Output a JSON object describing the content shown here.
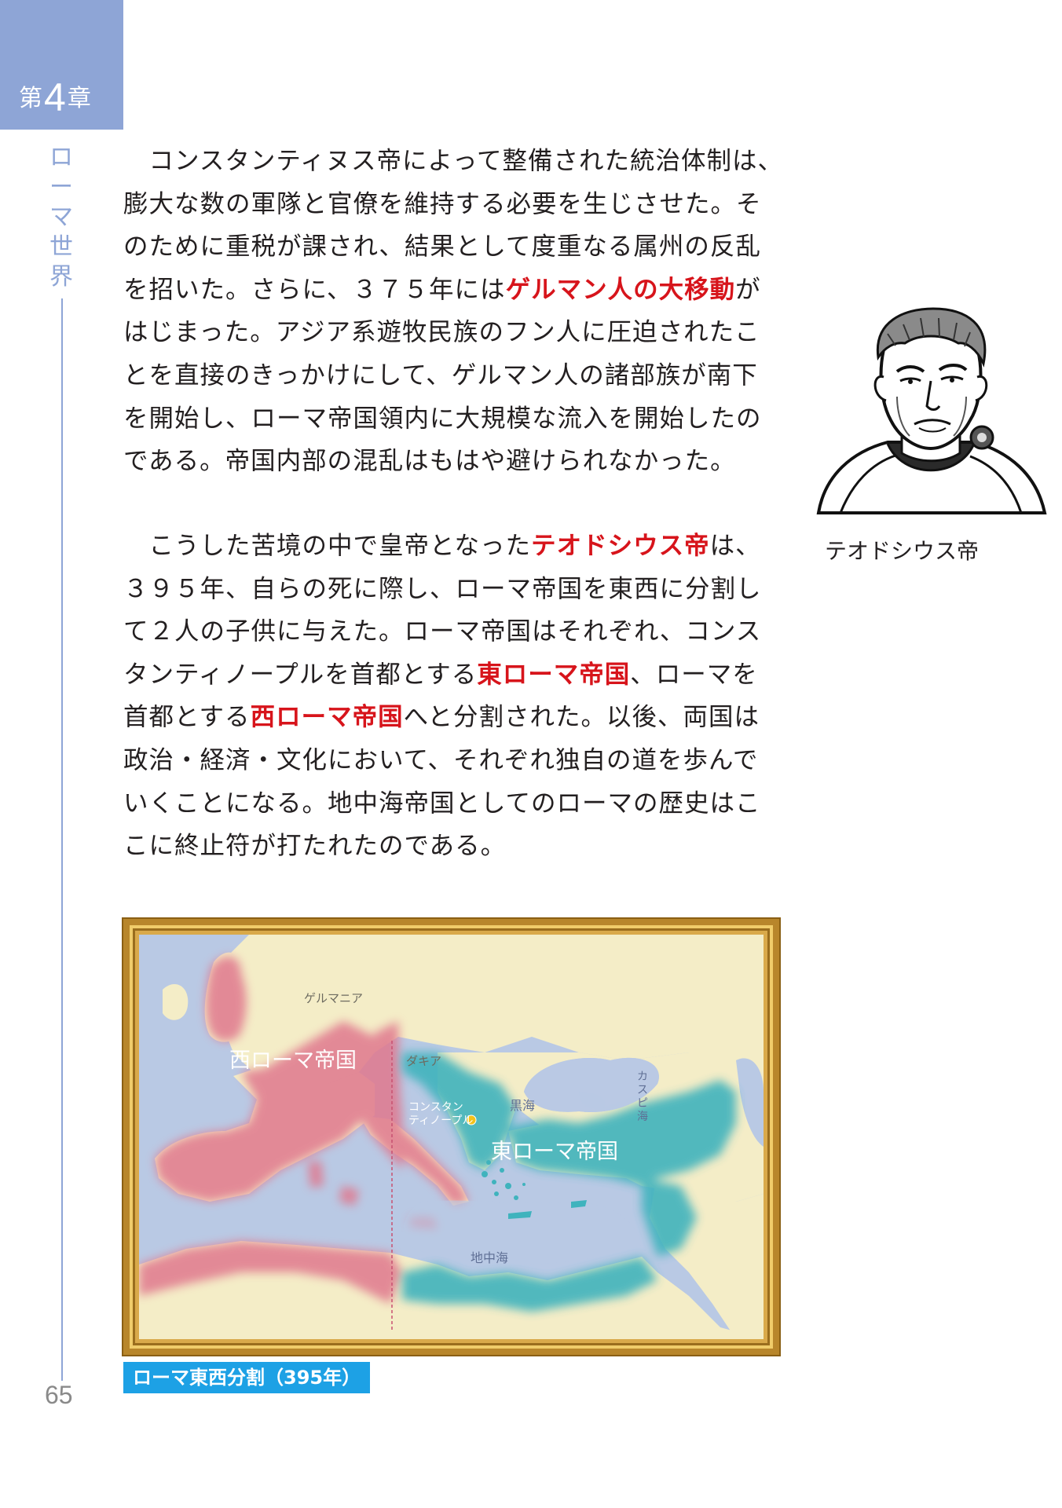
{
  "chapter": {
    "prefix": "第",
    "number": "4",
    "suffix": "章"
  },
  "section_title_chars": [
    "ロ",
    "ー",
    "マ",
    "世",
    "界"
  ],
  "page_number": "65",
  "para1": {
    "t1": "　コンスタンティヌス帝によって整備された統治体制は、膨大な数の軍隊と官僚を維持する必要を生じさせた。そのために重税が課され、結果として度重なる属州の反乱を招いた。さらに、３７５年には",
    "h1": "ゲルマン人の大移動",
    "t2": "がはじまった。アジア系遊牧民族のフン人に圧迫されたことを直接のきっかけにして、ゲルマン人の諸部族が南下を開始し、ローマ帝国領内に大規模な流入を開始したのである。帝国内部の混乱はもはや避けられなかった。"
  },
  "para2": {
    "t1": "　こうした苦境の中で皇帝となった",
    "h1": "テオドシウス帝",
    "t2": "は、３９５年、自らの死に際し、ローマ帝国を東西に分割して２人の子供に与えた。ローマ帝国はそれぞれ、コンスタンティノープルを首都とする",
    "h2": "東ローマ帝国",
    "t3": "、ローマを首都とする",
    "h3": "西ローマ帝国",
    "t4": "へと分割された。以後、両国は政治・経済・文化において、それぞれ独自の道を歩んでいくことになる。地中海帝国としてのローマの歴史はここに終止符が打たれたのである。"
  },
  "portrait": {
    "caption": "テオドシウス帝"
  },
  "map": {
    "germania": "ゲルマニア",
    "dacia": "ダキア",
    "west_empire": "西ローマ帝国",
    "east_empire": "東ローマ帝国",
    "city_line1": "コンスタン",
    "city_line2": "ティノープル",
    "black_sea": "黒海",
    "mediterranean": "地中海",
    "caspian_chars": [
      "カ",
      "ス",
      "ピ",
      "海"
    ],
    "caption": "ローマ東西分割（395年）",
    "colors": {
      "west": "#e0788e",
      "east": "#3fb3bd",
      "land": "#f4edc7",
      "sea": "#b9c9e4",
      "capital": "#f3c21a"
    }
  }
}
